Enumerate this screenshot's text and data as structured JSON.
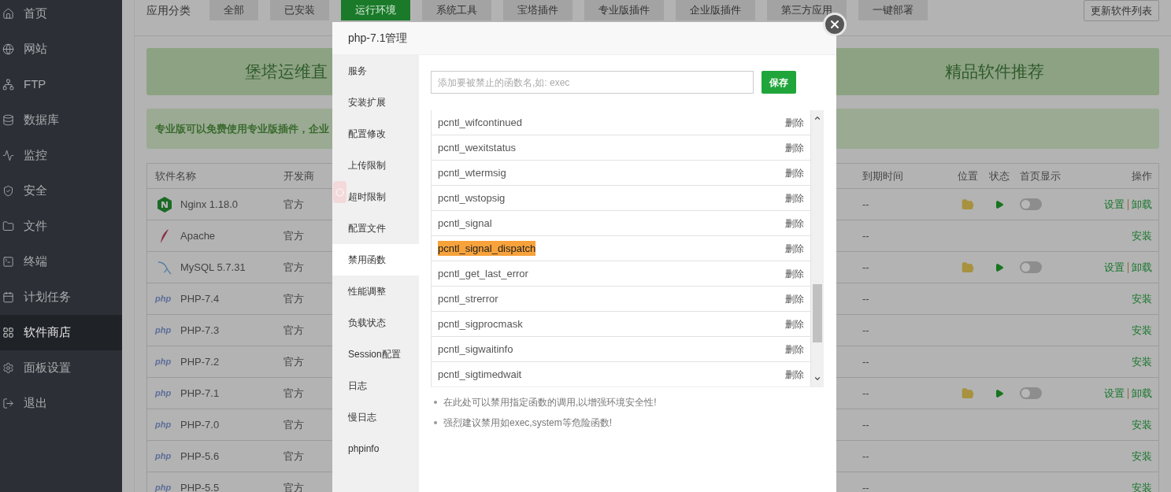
{
  "sidebar": {
    "items": [
      {
        "label": "首页",
        "selected": false
      },
      {
        "label": "网站",
        "selected": false
      },
      {
        "label": "FTP",
        "selected": false
      },
      {
        "label": "数据库",
        "selected": false
      },
      {
        "label": "监控",
        "selected": false
      },
      {
        "label": "安全",
        "selected": false
      },
      {
        "label": "文件",
        "selected": false
      },
      {
        "label": "终端",
        "selected": false
      },
      {
        "label": "计划任务",
        "selected": false
      },
      {
        "label": "软件商店",
        "selected": true
      },
      {
        "label": "面板设置",
        "selected": false
      },
      {
        "label": "退出",
        "selected": false
      }
    ]
  },
  "categories": {
    "label": "应用分类",
    "tabs": [
      {
        "label": "全部",
        "selected": false
      },
      {
        "label": "已安装",
        "selected": false
      },
      {
        "label": "运行环境",
        "selected": true
      },
      {
        "label": "系统工具",
        "selected": false
      },
      {
        "label": "宝塔插件",
        "selected": false
      },
      {
        "label": "专业版插件",
        "selected": false
      },
      {
        "label": "企业版插件",
        "selected": false
      },
      {
        "label": "第三方应用",
        "selected": false
      },
      {
        "label": "一键部署",
        "selected": false
      }
    ],
    "update_button": "更新软件列表"
  },
  "banners": [
    {
      "text": "堡塔运维直"
    },
    {
      "text": "精品软件推荐"
    }
  ],
  "notice": "专业版可以免费使用专业版插件，企业",
  "table": {
    "columns": [
      "软件名称",
      "开发商",
      "到期时间",
      "位置",
      "状态",
      "首页显示",
      "操作"
    ],
    "rows": [
      {
        "kind": "nginx",
        "name": "Nginx 1.18.0",
        "developer": "官方",
        "expiry": "--",
        "installed": true,
        "on": false,
        "actions": [
          "设置",
          "卸载"
        ]
      },
      {
        "kind": "apache",
        "name": "Apache",
        "developer": "官方",
        "expiry": "--",
        "installed": false,
        "actions": [
          "安装"
        ]
      },
      {
        "kind": "mysql",
        "name": "MySQL 5.7.31",
        "developer": "官方",
        "expiry": "--",
        "installed": true,
        "on": false,
        "actions": [
          "设置",
          "卸载"
        ]
      },
      {
        "kind": "php",
        "logo": "php",
        "name": "PHP-7.4",
        "developer": "官方",
        "expiry": "--",
        "installed": false,
        "actions": [
          "安装"
        ]
      },
      {
        "kind": "php",
        "logo": "php",
        "name": "PHP-7.3",
        "developer": "官方",
        "expiry": "--",
        "installed": false,
        "actions": [
          "安装"
        ]
      },
      {
        "kind": "php",
        "logo": "php",
        "name": "PHP-7.2",
        "developer": "官方",
        "expiry": "--",
        "installed": false,
        "actions": [
          "安装"
        ]
      },
      {
        "kind": "php",
        "logo": "php",
        "name": "PHP-7.1",
        "developer": "官方",
        "expiry": "--",
        "installed": true,
        "on": false,
        "actions": [
          "设置",
          "卸载"
        ]
      },
      {
        "kind": "php",
        "logo": "php",
        "name": "PHP-7.0",
        "developer": "官方",
        "expiry": "--",
        "installed": false,
        "actions": [
          "安装"
        ]
      },
      {
        "kind": "php",
        "logo": "php",
        "name": "PHP-5.6",
        "developer": "官方",
        "expiry": "--",
        "installed": false,
        "actions": [
          "安装"
        ]
      },
      {
        "kind": "php",
        "logo": "php",
        "name": "PHP-5.5",
        "developer": "官方",
        "expiry": "--",
        "installed": false,
        "actions": [
          "安装"
        ]
      }
    ]
  },
  "modal": {
    "title": "php-7.1管理",
    "nav": [
      {
        "label": "服务",
        "selected": false
      },
      {
        "label": "安装扩展",
        "selected": false
      },
      {
        "label": "配置修改",
        "selected": false
      },
      {
        "label": "上传限制",
        "selected": false
      },
      {
        "label": "超时限制",
        "selected": false
      },
      {
        "label": "配置文件",
        "selected": false
      },
      {
        "label": "禁用函数",
        "selected": true
      },
      {
        "label": "性能调整",
        "selected": false
      },
      {
        "label": "负载状态",
        "selected": false
      },
      {
        "label": "Session配置",
        "selected": false
      },
      {
        "label": "日志",
        "selected": false
      },
      {
        "label": "慢日志",
        "selected": false
      },
      {
        "label": "phpinfo",
        "selected": false
      }
    ],
    "input": {
      "placeholder": "添加要被禁止的函数名,如: exec"
    },
    "save_button": "保存",
    "functions": [
      {
        "name": "pcntl_wifcontinued",
        "action": "删除",
        "highlighted": false
      },
      {
        "name": "pcntl_wexitstatus",
        "action": "删除",
        "highlighted": false
      },
      {
        "name": "pcntl_wtermsig",
        "action": "删除",
        "highlighted": false
      },
      {
        "name": "pcntl_wstopsig",
        "action": "删除",
        "highlighted": false
      },
      {
        "name": "pcntl_signal",
        "action": "删除",
        "highlighted": false
      },
      {
        "name": "pcntl_signal_dispatch",
        "action": "删除",
        "highlighted": true
      },
      {
        "name": "pcntl_get_last_error",
        "action": "删除",
        "highlighted": false
      },
      {
        "name": "pcntl_strerror",
        "action": "删除",
        "highlighted": false
      },
      {
        "name": "pcntl_sigprocmask",
        "action": "删除",
        "highlighted": false
      },
      {
        "name": "pcntl_sigwaitinfo",
        "action": "删除",
        "highlighted": false
      },
      {
        "name": "pcntl_sigtimedwait",
        "action": "删除",
        "highlighted": false
      }
    ],
    "notes": [
      "在此处可以禁用指定函数的调用,以增强环境安全性!",
      "强烈建议禁用如exec,system等危险函数!"
    ]
  }
}
